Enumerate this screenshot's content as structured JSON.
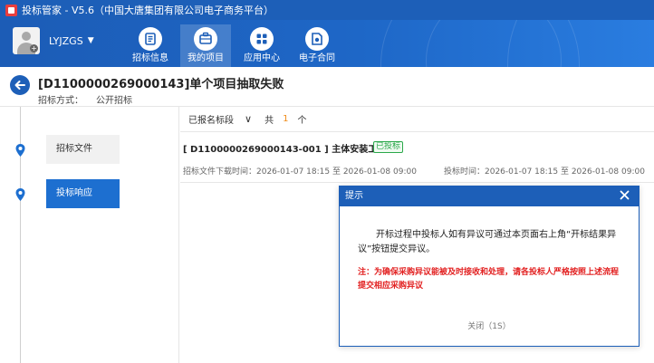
{
  "window": {
    "title": "投标管家 - V5.6（中国大唐集团有限公司电子商务平台）"
  },
  "user": {
    "name": "LYJZGS"
  },
  "nav": [
    {
      "label": "招标信息",
      "icon": "list-icon"
    },
    {
      "label": "我的项目",
      "icon": "briefcase-icon",
      "active": true
    },
    {
      "label": "应用中心",
      "icon": "grid-icon"
    },
    {
      "label": "电子合同",
      "icon": "contract-icon"
    }
  ],
  "page": {
    "title": "[D1100000269000143]单个项目抽取失败",
    "method_label": "招标方式：",
    "method_value": "公开招标"
  },
  "steps": [
    {
      "label": "招标文件",
      "active": false
    },
    {
      "label": "投标响应",
      "active": true
    }
  ],
  "filter": {
    "selected": "已报名标段",
    "total_prefix": "共",
    "count": "1",
    "count_unit": "个"
  },
  "project": {
    "title": "[ D1100000269000143-001 ] 主体安装工程",
    "status": "已投标",
    "download_time": "招标文件下载时间：2026-01-07 18:15 至 2026-01-08 09:00",
    "bid_time": "投标时间：2026-01-07 18:15 至 2026-01-08 09:00"
  },
  "dialog": {
    "title": "提示",
    "message": "开标过程中投标人如有异议可通过本页面右上角“开标结果异议”按钮提交异议。",
    "note": "注：为确保采购异议能被及时接收和处理，请各投标人严格按照上述流程提交相应采购异议",
    "close_label": "关闭（1S）"
  },
  "colors": {
    "primary": "#1d5fb8",
    "accent_active": "#1d6fd0",
    "count_orange": "#f08c1a",
    "success_green": "#2aa84a",
    "warning_red": "#e22020"
  }
}
